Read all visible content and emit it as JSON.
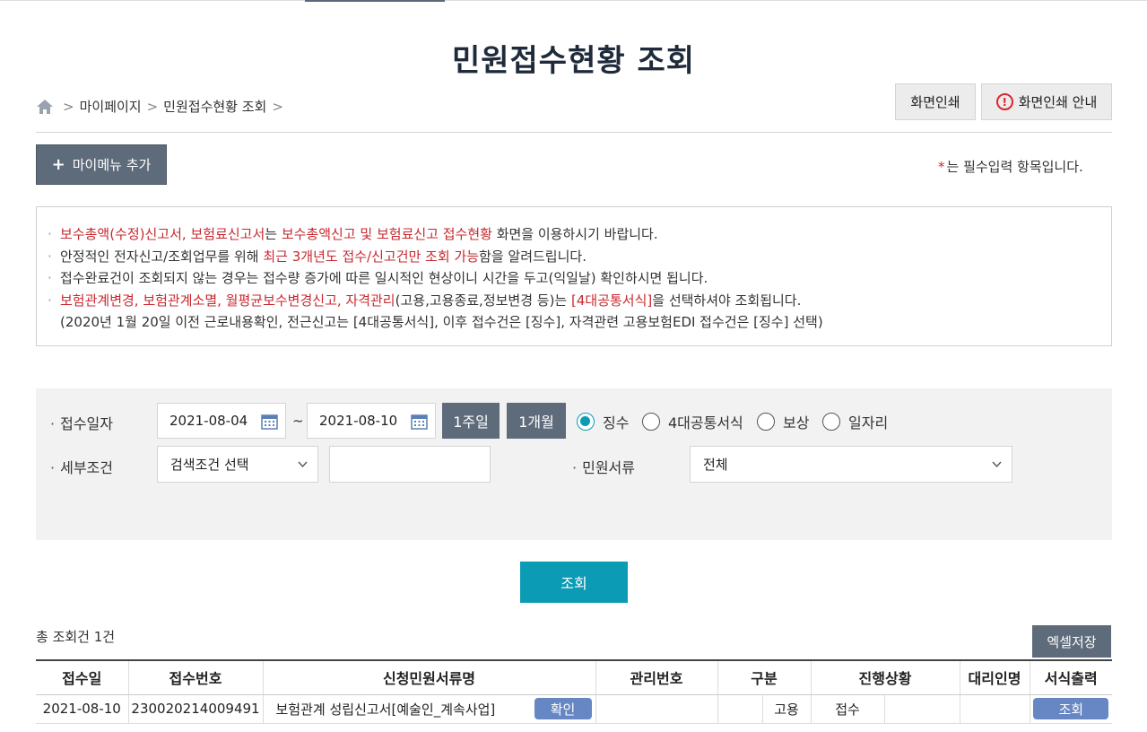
{
  "page": {
    "title": "민원접수현황 조회"
  },
  "breadcrumb": {
    "items": [
      "마이페이지",
      "민원접수현황 조회"
    ]
  },
  "actions": {
    "print": "화면인쇄",
    "print_guide": "화면인쇄 안내",
    "mymenu_add": "마이메뉴 추가"
  },
  "required_note": {
    "star": "*",
    "text": "는 필수입력 항목입니다."
  },
  "notice": {
    "line1": {
      "a": "보수총액(수정)신고서, 보험료신고서",
      "b": "는 ",
      "c": "보수총액신고 및 보험료신고 접수현황",
      "d": " 화면을 이용하시기 바랍니다."
    },
    "line2": {
      "a": "안정적인 전자신고/조회업무를 위해 ",
      "b": "최근 3개년도 접수/신고건만 조회 가능",
      "c": "함을 알려드립니다."
    },
    "line3": "접수완료건이 조회되지 않는 경우는 접수량 증가에 따른 일시적인 현상이니 시간을 두고(익일날) 확인하시면 됩니다.",
    "line4": {
      "a": "보험관계변경, 보험관계소멸, 월평균보수변경신고, 자격관리",
      "b": "(고용,고용종료,정보변경 등)는 ",
      "c": "[4대공통서식]",
      "d": "을 선택하셔야 조회됩니다."
    },
    "line5": "(2020년 1월 20일 이전 근로내용확인, 전근신고는 [4대공통서식], 이후 접수건은 [징수], 자격관련 고용보험EDI 접수건은 [징수] 선택)"
  },
  "search": {
    "date_label": "접수일자",
    "date_from": "2021-08-04",
    "date_to": "2021-08-10",
    "tilde": "~",
    "period_1w": "1주일",
    "period_1m": "1개월",
    "radios": [
      "징수",
      "4대공통서식",
      "보상",
      "일자리"
    ],
    "selected_radio": "징수",
    "detail_label": "세부조건",
    "detail_select": "검색조건 선택",
    "detail_input": "",
    "doc_label": "민원서류",
    "doc_select": "전체",
    "search_btn": "조회"
  },
  "results": {
    "total": "총 조회건 1건",
    "excel_btn": "엑셀저장",
    "columns": [
      "접수일",
      "접수번호",
      "신청민원서류명",
      "관리번호",
      "구분",
      "진행상황",
      "대리인명",
      "서식출력"
    ],
    "rows": [
      {
        "date": "2021-08-10",
        "number": "230020214009491",
        "doc": "보험관계 성립신고서[예술인_계속사업]",
        "confirm": "확인",
        "mgmt": "",
        "type": "고용",
        "status": "접수",
        "agent": "",
        "print": "조회"
      }
    ]
  },
  "colors": {
    "accent": "#0c9bb5",
    "dark_btn": "#5e6b7a",
    "red": "#c8282e",
    "pill": "#6687c4"
  }
}
